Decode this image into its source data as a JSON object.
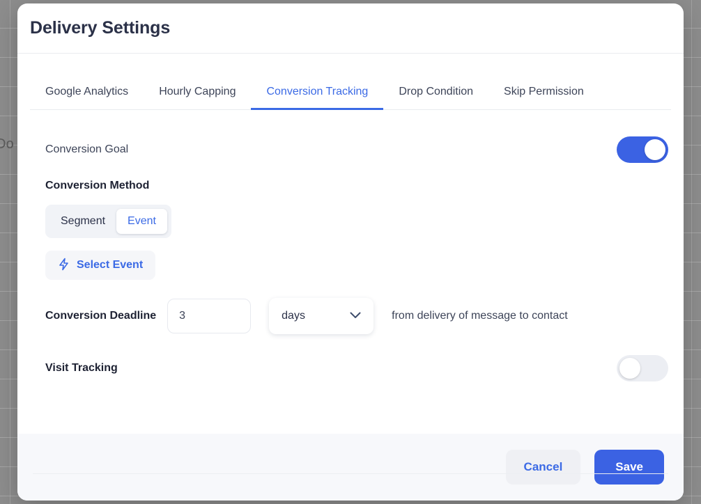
{
  "backdrop": {
    "visible_text": "Do"
  },
  "modal": {
    "title": "Delivery Settings",
    "tabs": [
      {
        "label": "Google Analytics",
        "active": false
      },
      {
        "label": "Hourly Capping",
        "active": false
      },
      {
        "label": "Conversion Tracking",
        "active": true
      },
      {
        "label": "Drop Condition",
        "active": false
      },
      {
        "label": "Skip Permission",
        "active": false
      }
    ],
    "conversion_goal": {
      "label": "Conversion Goal",
      "toggle_state": "on"
    },
    "conversion_method": {
      "label": "Conversion Method",
      "options": [
        {
          "label": "Segment",
          "selected": false
        },
        {
          "label": "Event",
          "selected": true
        }
      ],
      "select_event_button": {
        "label": "Select Event",
        "icon": "lightning-bolt-icon"
      }
    },
    "conversion_deadline": {
      "label": "Conversion Deadline",
      "value": "3",
      "unit": "days",
      "unit_options": [
        "days"
      ],
      "trailing_text": "from delivery of message to contact"
    },
    "visit_tracking": {
      "label": "Visit Tracking",
      "toggle_state": "off"
    },
    "footer": {
      "cancel_label": "Cancel",
      "save_label": "Save"
    }
  },
  "colors": {
    "accent_blue": "#3b62e3",
    "link_blue": "#3b6ae5",
    "text_dark": "#2b3148",
    "text_body": "#3d4458",
    "toggle_off": "#eceef3",
    "footer_bg": "#f7f8fb"
  }
}
